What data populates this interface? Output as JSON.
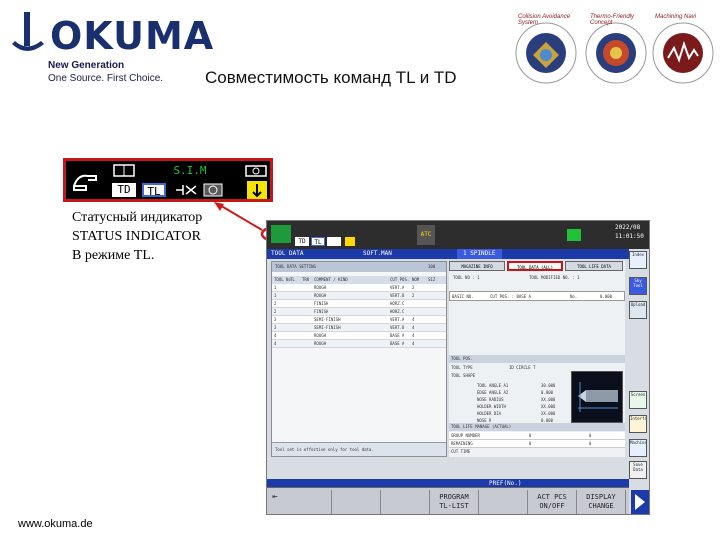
{
  "header": {
    "logo_text": "OKUMA",
    "tagline_1": "New Generation",
    "tagline_2": "One Source. First Choice.",
    "title": "Совместимость команд TL и TD"
  },
  "badges": [
    {
      "label": "Collision Avoidance System",
      "color": "#c8a338"
    },
    {
      "label": "Thermo-Friendly Concept",
      "color": "#c44a2b"
    },
    {
      "label": "Machining Navi",
      "color": "#7b1a1a"
    }
  ],
  "status_indicator": {
    "mode": "S.I.M",
    "td": "TD",
    "tl": "TL"
  },
  "caption": [
    "Статусный индикатор",
    "STATUS INDICATOR",
    "В режиме TL."
  ],
  "screen": {
    "top_bar": {
      "td": "TD",
      "tl": "TL",
      "atc": "ATC",
      "date": "2022/08",
      "time": "11:01:50"
    },
    "blue_bar": {
      "title": "TOOL DATA",
      "sub": "SOFT.MAN",
      "spindle": "1 SPINDLE"
    },
    "left_panel": {
      "header": "TOOL DATA SETTING",
      "count": "100",
      "columns": [
        "TOOL No",
        "TL",
        "TRK",
        "COMMENT / KIND",
        "CUT POS.",
        "NOM",
        "SIZ"
      ],
      "rows": [
        [
          "1",
          "",
          "",
          "ROUGH",
          "VERT.A",
          "2",
          ""
        ],
        [
          "1",
          "",
          "",
          "ROUGH",
          "VERT.B",
          "2",
          ""
        ],
        [
          "2",
          "",
          "",
          "FINISH",
          "HORZ.C",
          "",
          ""
        ],
        [
          "2",
          "",
          "",
          "FINISH",
          "HORZ.C",
          "",
          ""
        ],
        [
          "3",
          "",
          "",
          "SEMI-FINISH",
          "VERT.A",
          "4",
          ""
        ],
        [
          "3",
          "",
          "",
          "SEMI-FINISH",
          "VERT.B",
          "4",
          ""
        ],
        [
          "4",
          "",
          "",
          "ROUGH",
          "BASE A",
          "4",
          ""
        ],
        [
          "4",
          "",
          "",
          "ROUGH",
          "BASE A",
          "4",
          ""
        ]
      ],
      "footer": "Tool set is effective only for tool data."
    },
    "right_panel": {
      "tabs": [
        "MAGAZINE INFO",
        "TOOL DATA (ALL)",
        "TOOL LIFE DATA"
      ],
      "tool_no": "TOOL NO : 1",
      "tool_modified": "TOOL MODIFIED NO. : 1",
      "basic_no": "BASIC NO.",
      "cut_pos": "CUT POS. : BASE A",
      "no_label": "No.",
      "no_value": "0.000",
      "shape_section": "TOOL POS.",
      "tool_type_label": "TOOL TYPE",
      "tool_type": "ID CIRCLE T",
      "tool_shape": "TOOL SHAPE",
      "params": [
        {
          "label": "TOOL ANGLE A1",
          "value": "30.000"
        },
        {
          "label": "EDGE ANGLE A2",
          "value": "0.000"
        },
        {
          "label": "NOSE RADIUS",
          "value": "XX.000"
        },
        {
          "label": "HOLDER WIDTH",
          "value": "XX.000"
        },
        {
          "label": "HOLDER DIA",
          "value": "XX.000"
        },
        {
          "label": "NOSE R",
          "value": "0.000"
        }
      ],
      "life_section": "TOOL LIFE MANAGE (ACTUAL)",
      "life_rows": [
        {
          "label": "GROUP NUMBER",
          "set": "0",
          "actual": "0"
        },
        {
          "label": "REMAINING",
          "set": "0",
          "actual": "0"
        }
      ],
      "cut_time": "CUT TIME"
    },
    "pref_bar": "PREF(No.)",
    "side_buttons": [
      "Index",
      "Sky Tool",
      "Upload",
      "Screen",
      "Interfaced",
      "Machine",
      "Save Data"
    ],
    "fkeys": [
      {
        "line1": "",
        "line2": ""
      },
      {
        "line1": "",
        "line2": ""
      },
      {
        "line1": "",
        "line2": ""
      },
      {
        "line1": "PROGRAM",
        "line2": "TL-LIST"
      },
      {
        "line1": "",
        "line2": ""
      },
      {
        "line1": "ACT PCS",
        "line2": "ON/OFF"
      },
      {
        "line1": "DISPLAY",
        "line2": "CHANGE"
      }
    ]
  },
  "footer": {
    "website": "www.okuma.de"
  }
}
